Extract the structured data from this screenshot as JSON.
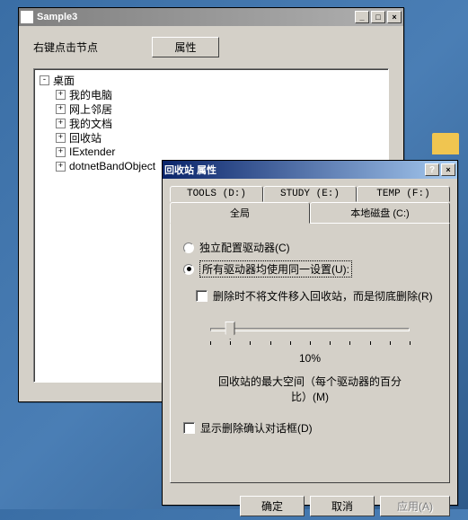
{
  "desktop_icon": "folder",
  "window1": {
    "title": "Sample3",
    "instruction": "右键点击节点",
    "properties_button": "属性",
    "tree": {
      "root": "桌面",
      "nodes": [
        "我的电脑",
        "网上邻居",
        "我的文档",
        "回收站",
        "IExtender",
        "dotnetBandObject"
      ]
    }
  },
  "window2": {
    "title": "回收站 属性",
    "tabs_back": [
      "TOOLS (D:)",
      "STUDY (E:)",
      "TEMP (F:)"
    ],
    "tabs_front": [
      "全局",
      "本地磁盘 (C:)"
    ],
    "active_tab": "全局",
    "radio1": "独立配置驱动器(C)",
    "radio2": "所有驱动器均使用同一设置(U):",
    "check1": "删除时不将文件移入回收站，而是彻底删除(R)",
    "slider": {
      "value": 10,
      "display": "10%",
      "label": "回收站的最大空间（每个驱动器的百分比）(M)"
    },
    "check2": "显示删除确认对话框(D)",
    "buttons": {
      "ok": "确定",
      "cancel": "取消",
      "apply": "应用(A)"
    }
  }
}
